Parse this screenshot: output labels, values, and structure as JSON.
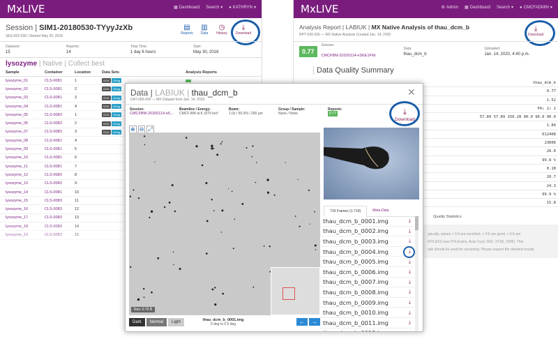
{
  "left": {
    "brand": "MxLIVE",
    "nav": [
      "Dashboard",
      "Search",
      "KATHRYN"
    ],
    "title_prefix": "Session |",
    "title": "SIM1-20180530-TYyyJzXb",
    "subtitle": "SES-002-536 | Started May 30, 2018",
    "tools": [
      {
        "label": "Reports",
        "badge": "13"
      },
      {
        "label": "Data",
        "badge": "25"
      },
      {
        "label": "History",
        "badge": ""
      },
      {
        "label": "Download",
        "badge": ""
      }
    ],
    "stats": [
      {
        "label": "Datasets:",
        "value": "15"
      },
      {
        "label": "Reports:",
        "value": "14"
      },
      {
        "label": "Total Time:",
        "value": "1 day 6 hours"
      },
      {
        "label": "Start:",
        "value": "May 30, 2018"
      }
    ],
    "group_name": "lysozyme",
    "group_native": "Native",
    "group_best": "Collect best",
    "headers": [
      "Sample",
      "Container",
      "Location",
      "Data Sets",
      "Analysis Reports"
    ],
    "rows": [
      {
        "s": "lysozyme_01",
        "c": "CLS-0081",
        "l": "1",
        "d": true
      },
      {
        "s": "lysozyme_02",
        "c": "CLS-0081",
        "l": "2",
        "d": true
      },
      {
        "s": "lysozyme_03",
        "c": "CLS-0081",
        "l": "3",
        "d": true
      },
      {
        "s": "lysozyme_04",
        "c": "CLS-0081",
        "l": "4",
        "d": true
      },
      {
        "s": "lysozyme_05",
        "c": "CLS-0083",
        "l": "1",
        "d": true
      },
      {
        "s": "lysozyme_06",
        "c": "CLS-0083",
        "l": "2",
        "d": true
      },
      {
        "s": "lysozyme_07",
        "c": "CLS-0083",
        "l": "3",
        "d": true
      },
      {
        "s": "lysozyme_08",
        "c": "CLS-0081",
        "l": "4",
        "d": false
      },
      {
        "s": "lysozyme_09",
        "c": "CLS-0081",
        "l": "5",
        "d": false
      },
      {
        "s": "lysozyme_10",
        "c": "CLS-0081",
        "l": "6",
        "d": false
      },
      {
        "s": "lysozyme_11",
        "c": "CLS-0081",
        "l": "7",
        "d": false
      },
      {
        "s": "lysozyme_12",
        "c": "CLS-0083",
        "l": "8",
        "d": false
      },
      {
        "s": "lysozyme_13",
        "c": "CLS-0083",
        "l": "9",
        "d": false
      },
      {
        "s": "lysozyme_14",
        "c": "CLS-0081",
        "l": "10",
        "d": false
      },
      {
        "s": "lysozyme_15",
        "c": "CLS-0083",
        "l": "11",
        "d": false
      },
      {
        "s": "lysozyme_16",
        "c": "CLS-0083",
        "l": "12",
        "d": false
      },
      {
        "s": "lysozyme_17",
        "c": "CLS-0083",
        "l": "13",
        "d": false
      },
      {
        "s": "lysozyme_18",
        "c": "CLS-0083",
        "l": "14",
        "d": false
      },
      {
        "s": "lysozyme_19",
        "c": "CLS-0083",
        "l": "15",
        "d": false
      }
    ],
    "ds_tags": [
      "GCK",
      "8 img"
    ]
  },
  "right": {
    "brand": "MxLIVE",
    "nav": [
      "Admin",
      "Dashboard",
      "Search",
      "CMCFADMIN"
    ],
    "title_prefix": "Analysis Report | LABIUK |",
    "title": "MX Native Analysis of thau_dcm_b",
    "subtitle": "RPT-030-330 — MX Native Analysis Created Jan. 14, 2020",
    "download": "Download",
    "score": "0.77",
    "stats": [
      {
        "label": "Session:",
        "value": "CMCFBM-20200114-eSKE1FNr"
      },
      {
        "label": "Data:",
        "value": "thau_dcm_b"
      },
      {
        "label": "Uploaded:",
        "value": "Jan. 14, 2020, 4:40 p.m."
      }
    ],
    "section": "Data Quality Summary",
    "values": [
      "thau_dcm_b",
      "0.77",
      "1.52",
      "P4₂ 2₂ 2",
      "57.89 57.89 150.28 90.0 90.0 90.0",
      "1.84",
      "612408",
      "23006",
      "26.6",
      "99.8 %",
      "0.18",
      "20.7",
      "24.3",
      "99.9 %",
      "15.8"
    ],
    "quality_title": "Quality Statistics",
    "notes": [
      "ypically, values > 0.8 are excellent, > 0.6 are good, > 0.5 are",
      "INTLESS (see P.R.Evans, Acta Cryst. D62, 72-82, 2006). This",
      "ode should be used for screening. Please inspect the detailed results"
    ]
  },
  "modal": {
    "title_prefix": "Data |",
    "title_mid": "LABIUK |",
    "title": "thau_dcm_b",
    "subtitle": "DAT-099-435 — MX Dataset from Jan. 14, 2020",
    "info": [
      {
        "label": "Session:",
        "value": "CMCFBM-20200114-e5..."
      },
      {
        "label": "Beamline / Energy:",
        "value": "CMCF-BM at 8.1570 keV"
      },
      {
        "label": "Beam:",
        "value": "1.0s / 50.0% / 200 μm"
      },
      {
        "label": "Group / Sample:",
        "value": "None / None"
      },
      {
        "label": "Reports:",
        "value": "0.77"
      }
    ],
    "download": "Download",
    "res": "Res: 0.70 Å",
    "modes": [
      "Dark",
      "Normal",
      "Light"
    ],
    "frame_name": "thau_dcm_b_0001.img",
    "frame_range": "0 deg to 0.5 deg",
    "tabs": [
      "719 Frames (1-719)",
      "Meta-Data"
    ],
    "frames": [
      "thau_dcm_b_0001.img",
      "thau_dcm_b_0002.img",
      "thau_dcm_b_0003.img",
      "thau_dcm_b_0004.img",
      "thau_dcm_b_0005.img",
      "thau_dcm_b_0006.img",
      "thau_dcm_b_0007.img",
      "thau_dcm_b_0008.img",
      "thau_dcm_b_0009.img",
      "thau_dcm_b_0010.img",
      "thau_dcm_b_0011.img",
      "thau_dcm_b_0012.img"
    ]
  }
}
